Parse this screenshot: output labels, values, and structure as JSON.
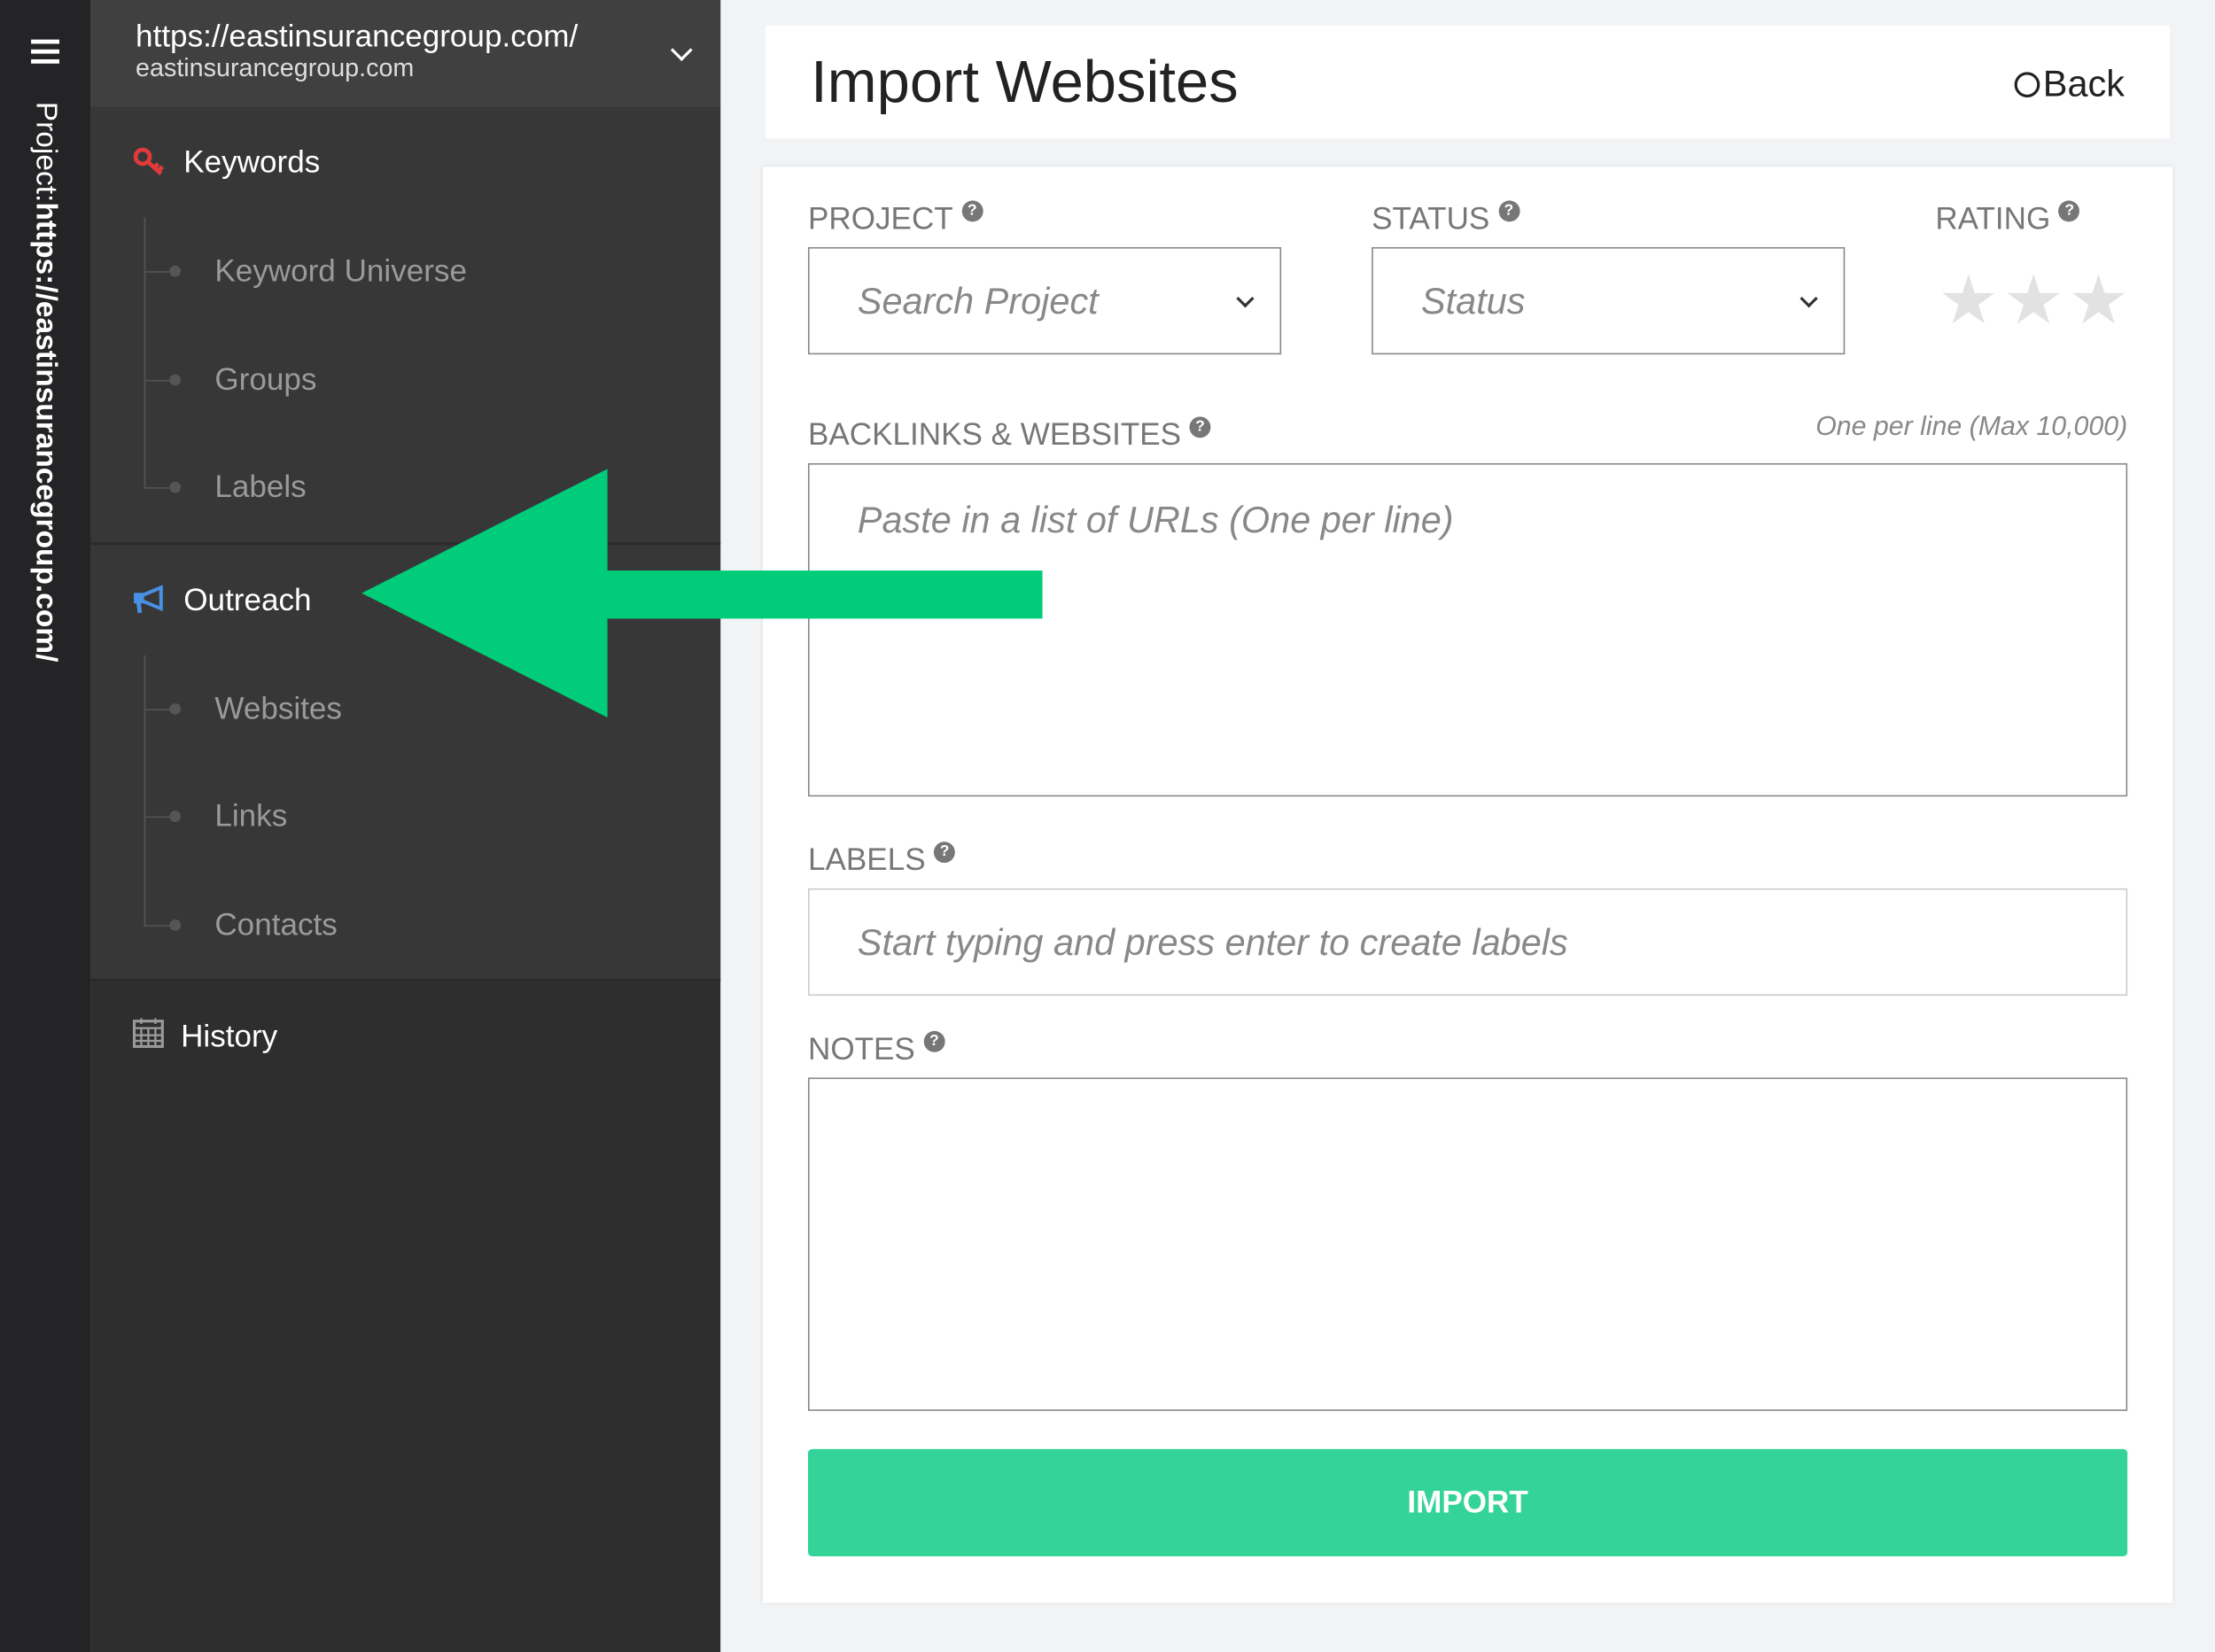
{
  "rail": {
    "project_prefix": "Project:",
    "project_url": "https://eastinsurancegroup.com/"
  },
  "project_switcher": {
    "url": "https://eastinsurancegroup.com/",
    "domain": "eastinsurancegroup.com"
  },
  "sidebar": {
    "keywords": {
      "label": "Keywords",
      "icon": "key-icon",
      "items": [
        "Keyword Universe",
        "Groups",
        "Labels"
      ]
    },
    "outreach": {
      "label": "Outreach",
      "icon": "megaphone-icon",
      "items": [
        "Websites",
        "Links",
        "Contacts"
      ]
    },
    "history": {
      "label": "History",
      "icon": "calendar-icon"
    }
  },
  "header": {
    "title": "Import Websites",
    "back_label": "Back"
  },
  "form": {
    "project": {
      "label": "PROJECT",
      "placeholder": "Search Project"
    },
    "status": {
      "label": "STATUS",
      "placeholder": "Status"
    },
    "rating": {
      "label": "RATING",
      "value": 0,
      "max": 3
    },
    "backlinks": {
      "label": "BACKLINKS & WEBSITES",
      "hint": "One per line (Max 10,000)",
      "placeholder": "Paste in a list of URLs (One per line)"
    },
    "labels": {
      "label": "LABELS",
      "placeholder": "Start typing and press enter to create labels"
    },
    "notes": {
      "label": "NOTES",
      "value": ""
    },
    "help_glyph": "?",
    "import_label": "IMPORT"
  },
  "colors": {
    "accent": "#33d399",
    "annotation_arrow": "#00cc7a",
    "keyword_icon": "#e03a3a",
    "outreach_icon": "#4a90e2"
  }
}
